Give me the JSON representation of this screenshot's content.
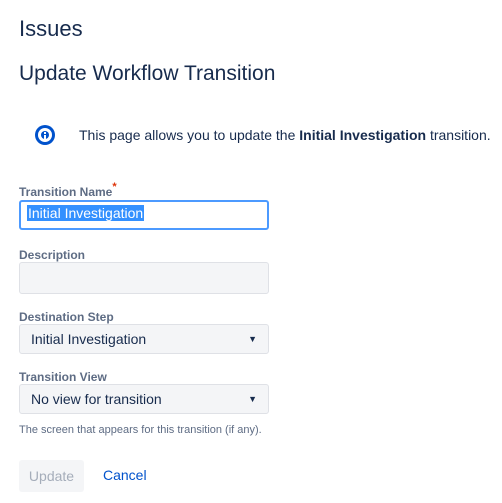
{
  "header": {
    "section_title": "Issues",
    "page_title": "Update Workflow Transition"
  },
  "info": {
    "prefix": "This page allows you to update the ",
    "bold_name": "Initial Investigation",
    "suffix": " transition.",
    "icon": "info-icon",
    "icon_color": "#0052cc"
  },
  "form": {
    "transition_name": {
      "label": "Transition Name",
      "required_marker": "*",
      "value": "Initial Investigation"
    },
    "description": {
      "label": "Description",
      "value": ""
    },
    "destination_step": {
      "label": "Destination Step",
      "selected": "Initial Investigation",
      "caret": "▼"
    },
    "transition_view": {
      "label": "Transition View",
      "selected": "No view for transition",
      "caret": "▼",
      "help": "The screen that appears for this transition (if any)."
    }
  },
  "actions": {
    "update_label": "Update",
    "cancel_label": "Cancel"
  },
  "colors": {
    "link": "#0052cc",
    "required": "#de350b",
    "focus_border": "#4c9aff"
  }
}
